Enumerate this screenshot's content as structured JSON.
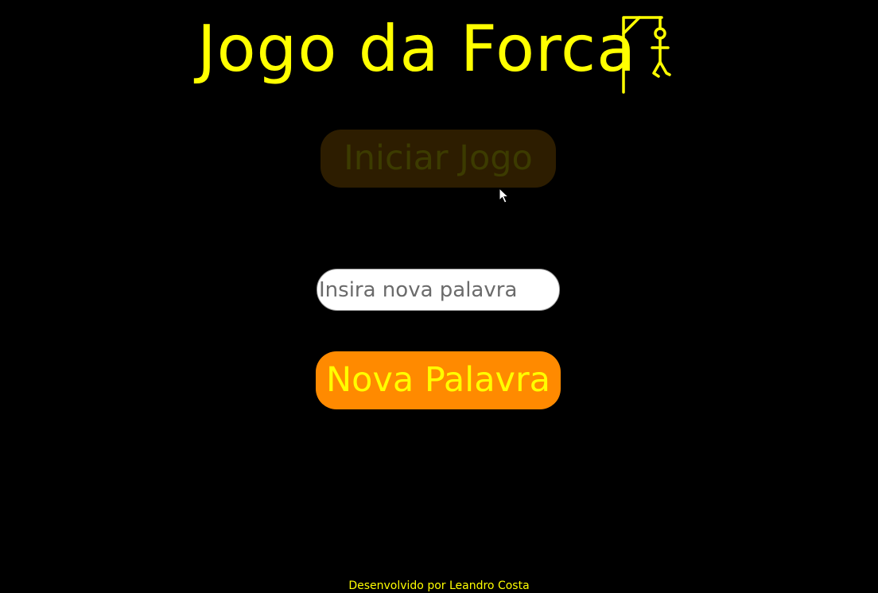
{
  "header": {
    "title": "Jogo da Forca",
    "logo_icon": "gallows-hangman-icon"
  },
  "main": {
    "start_button_label": "Iniciar Jogo",
    "new_word_placeholder": "Insira nova palavra",
    "new_word_value": "",
    "new_word_button_label": "Nova Palavra"
  },
  "footer": {
    "credit": "Desenvolvido por Leandro Costa"
  },
  "colors": {
    "background": "#000000",
    "text_accent": "#ffff00",
    "start_button_bg": "#2d1d00",
    "new_word_button_bg": "#ff8a00"
  }
}
